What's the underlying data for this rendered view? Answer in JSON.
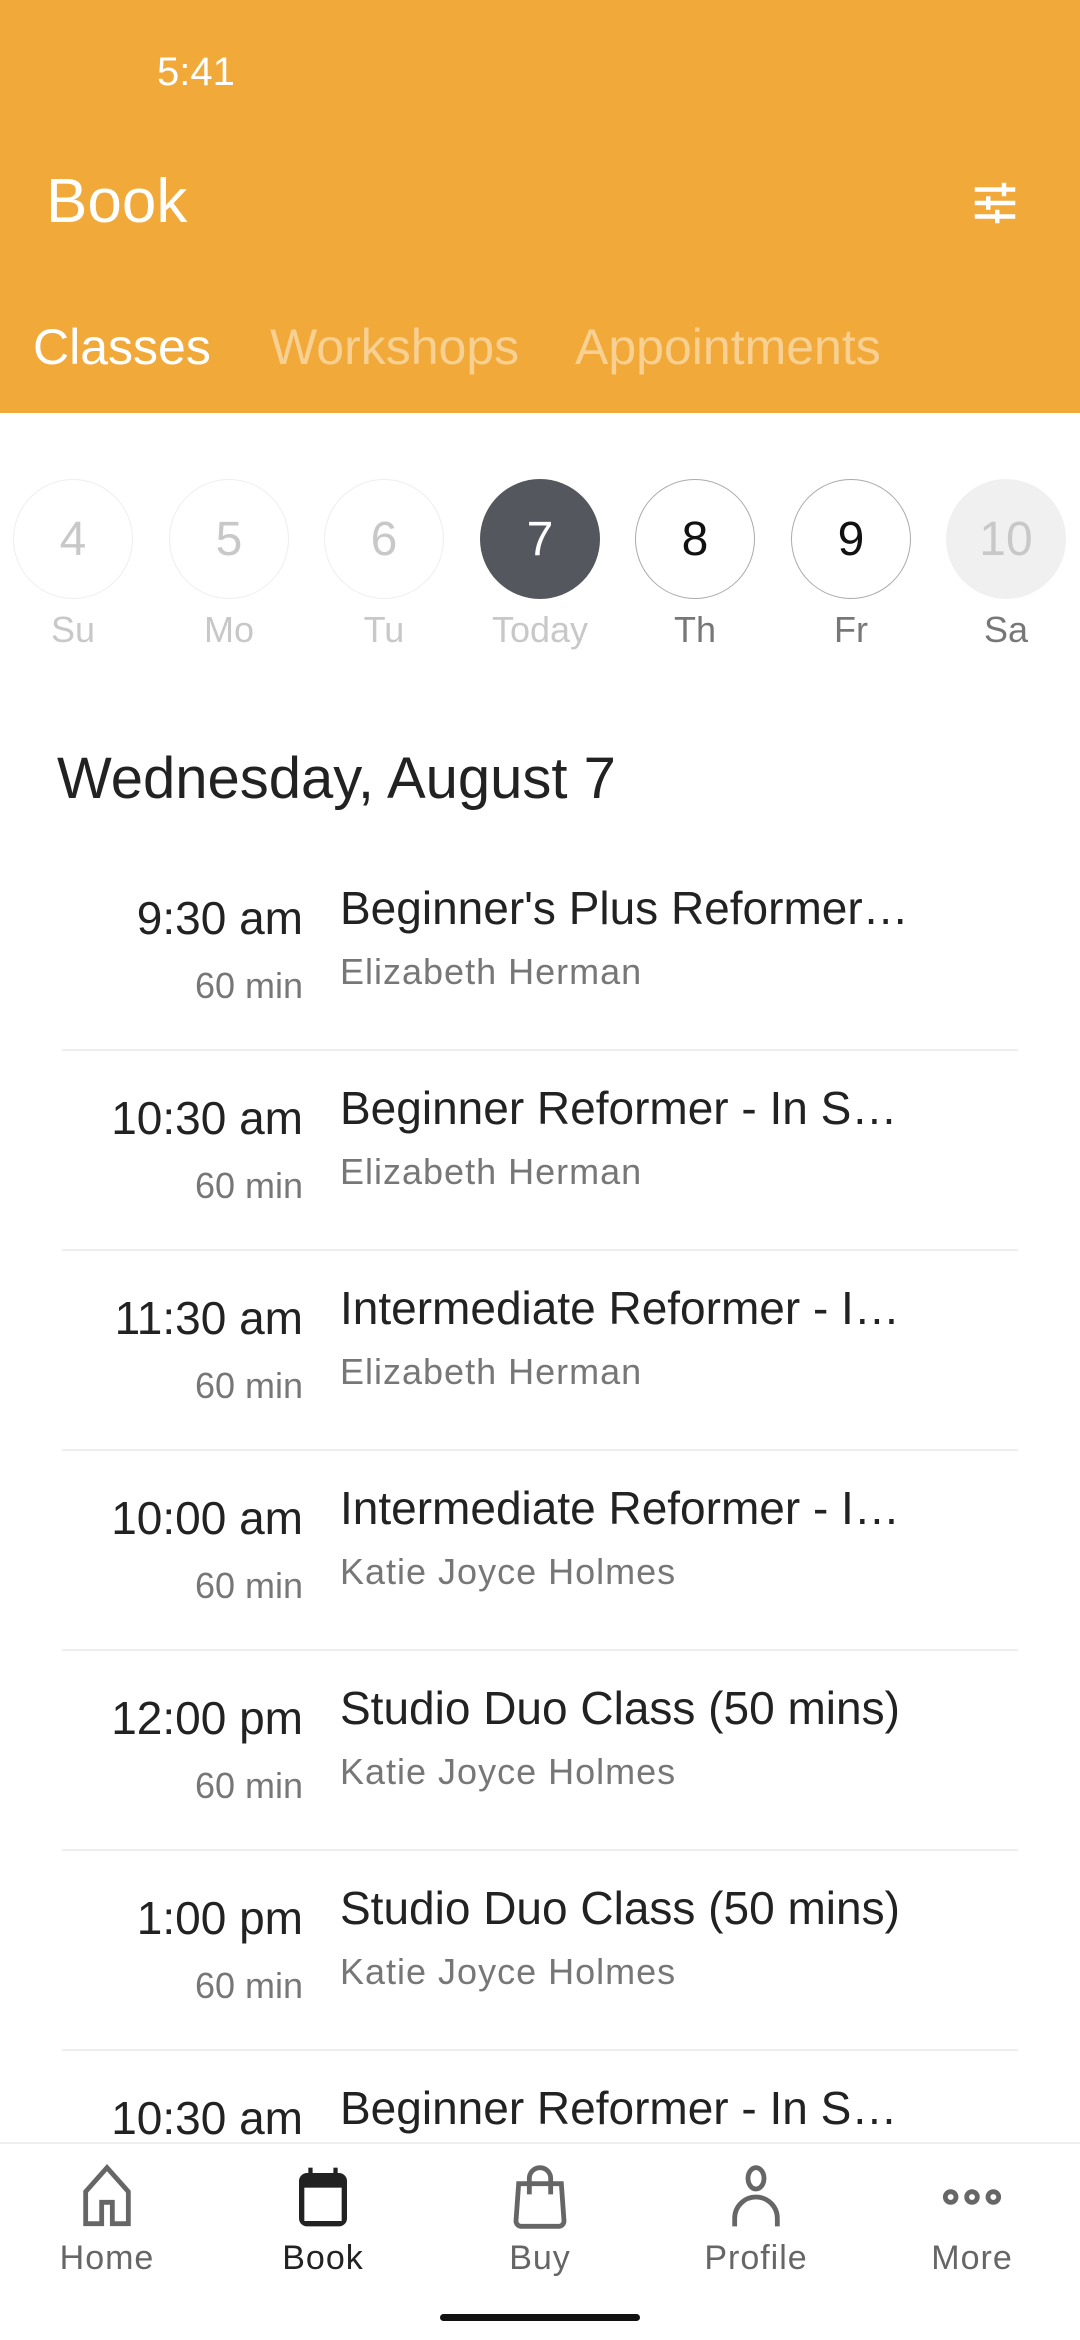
{
  "status": {
    "time": "5:41"
  },
  "header": {
    "title": "Book",
    "filter_icon": "sliders-icon",
    "accent": "#f1a93a"
  },
  "tabs": [
    {
      "label": "Classes",
      "active": true
    },
    {
      "label": "Workshops"
    },
    {
      "label": "Appointments"
    }
  ],
  "days": [
    {
      "num": "4",
      "label": "Su",
      "state": "past"
    },
    {
      "num": "5",
      "label": "Mo",
      "state": "past"
    },
    {
      "num": "6",
      "label": "Tu",
      "state": "past"
    },
    {
      "num": "7",
      "label": "Today",
      "state": "selected"
    },
    {
      "num": "8",
      "label": "Th",
      "state": "future"
    },
    {
      "num": "9",
      "label": "Fr",
      "state": "future"
    },
    {
      "num": "10",
      "label": "Sa",
      "state": "unavailable"
    }
  ],
  "date_heading": "Wednesday, August 7",
  "classes": [
    {
      "time": "9:30 am",
      "duration": "60 min",
      "title": "Beginner's Plus Reformer…",
      "instructor": "Elizabeth Herman"
    },
    {
      "time": "10:30 am",
      "duration": "60 min",
      "title": "Beginner Reformer - In S…",
      "instructor": "Elizabeth Herman"
    },
    {
      "time": "11:30 am",
      "duration": "60 min",
      "title": "Intermediate Reformer - I…",
      "instructor": "Elizabeth Herman"
    },
    {
      "time": "10:00 am",
      "duration": "60 min",
      "title": "Intermediate Reformer - I…",
      "instructor": "Katie Joyce Holmes"
    },
    {
      "time": "12:00 pm",
      "duration": "60 min",
      "title": "Studio Duo Class (50 mins)",
      "instructor": "Katie Joyce Holmes"
    },
    {
      "time": "1:00 pm",
      "duration": "60 min",
      "title": "Studio Duo Class (50 mins)",
      "instructor": "Katie Joyce Holmes"
    },
    {
      "time": "10:30 am",
      "duration": "",
      "title": "Beginner Reformer - In S…",
      "instructor": ""
    }
  ],
  "nav": [
    {
      "label": "Home",
      "icon": "home-icon"
    },
    {
      "label": "Book",
      "icon": "calendar-icon",
      "active": true
    },
    {
      "label": "Buy",
      "icon": "shopping-bag-icon"
    },
    {
      "label": "Profile",
      "icon": "person-icon"
    },
    {
      "label": "More",
      "icon": "more-icon"
    }
  ]
}
